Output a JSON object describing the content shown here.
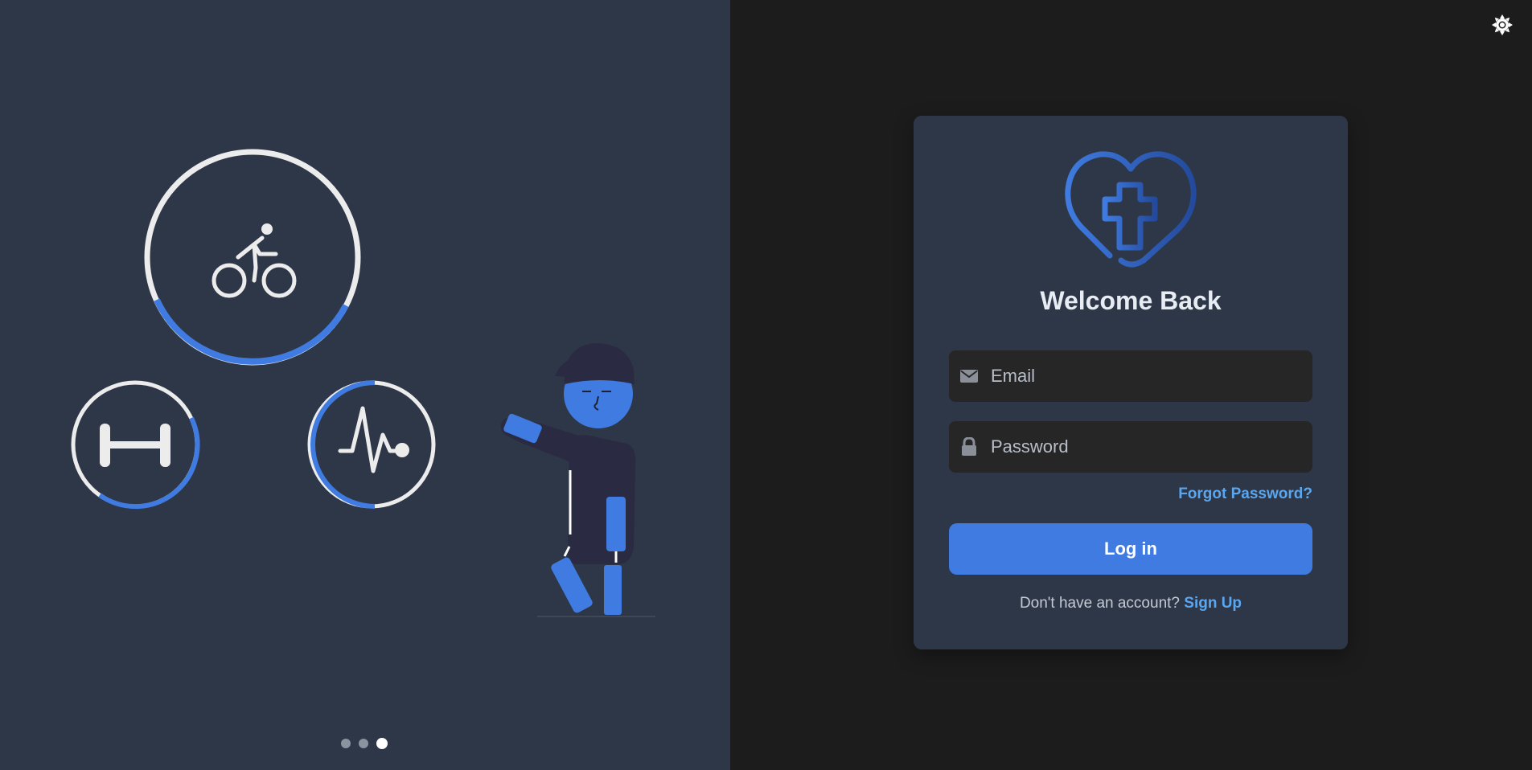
{
  "carousel": {
    "slides": [
      "slide-1",
      "slide-2",
      "slide-3"
    ],
    "active_index": 2
  },
  "illustration": {
    "activity_rings": [
      {
        "icon": "bicycle-icon",
        "progress_fraction": 0.35
      },
      {
        "icon": "dumbbell-icon",
        "progress_fraction": 0.4
      },
      {
        "icon": "heartbeat-icon",
        "progress_fraction": 0.55
      }
    ]
  },
  "theme_toggle": {
    "icon": "sun-icon"
  },
  "login": {
    "logo_icon": "heart-cross-icon",
    "title": "Welcome Back",
    "email_placeholder": "Email",
    "password_placeholder": "Password",
    "forgot_label": "Forgot Password?",
    "login_label": "Log in",
    "signup_prompt": "Don't have an account?",
    "signup_label": "Sign Up"
  },
  "colors": {
    "left_bg": "#2e3748",
    "right_bg": "#1c1c1c",
    "card_bg": "#2e3748",
    "accent": "#3f7be0",
    "link": "#5aa7f0",
    "input_bg": "#262626"
  }
}
